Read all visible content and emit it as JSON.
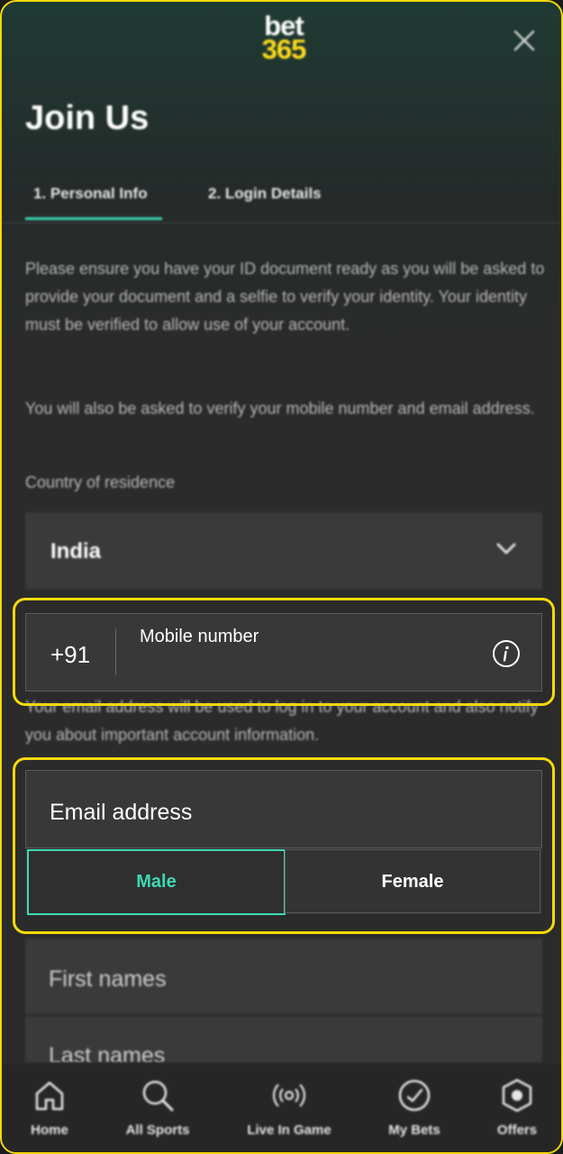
{
  "brand": {
    "logo_line1": "bet",
    "logo_line2": "365"
  },
  "header": {
    "title": "Join Us"
  },
  "tabs": [
    {
      "label": "1.  Personal Info",
      "active": true
    },
    {
      "label": "2.  Login Details",
      "active": false
    }
  ],
  "info": {
    "paragraph1": "Please ensure you have your ID document ready as you will be asked to provide your document and a selfie to verify your identity. Your identity must be verified to allow use of your account.",
    "paragraph2": "You will also be asked to verify your mobile number and email address."
  },
  "country": {
    "label": "Country of residence",
    "value": "India"
  },
  "mobile": {
    "country_code": "+91",
    "label": "Mobile number"
  },
  "email_note": "Your email address will be used to log in to your account and also notify you about important account information.",
  "email": {
    "label": "Email address"
  },
  "gender": {
    "male": "Male",
    "female": "Female",
    "selected": "Male"
  },
  "names": {
    "first": "First names",
    "last": "Last names"
  },
  "nav": [
    {
      "label": "Home",
      "icon": "home-icon"
    },
    {
      "label": "All Sports",
      "icon": "search-icon"
    },
    {
      "label": "Live In Game",
      "icon": "broadcast-icon"
    },
    {
      "label": "My Bets",
      "icon": "check-circle-icon"
    },
    {
      "label": "Offers",
      "icon": "offers-badge-icon"
    }
  ],
  "colors": {
    "accent": "#3dd9b5",
    "brand_yellow": "#ffdf1b",
    "highlight": "#f5d90a",
    "background": "#2b2b2b"
  }
}
